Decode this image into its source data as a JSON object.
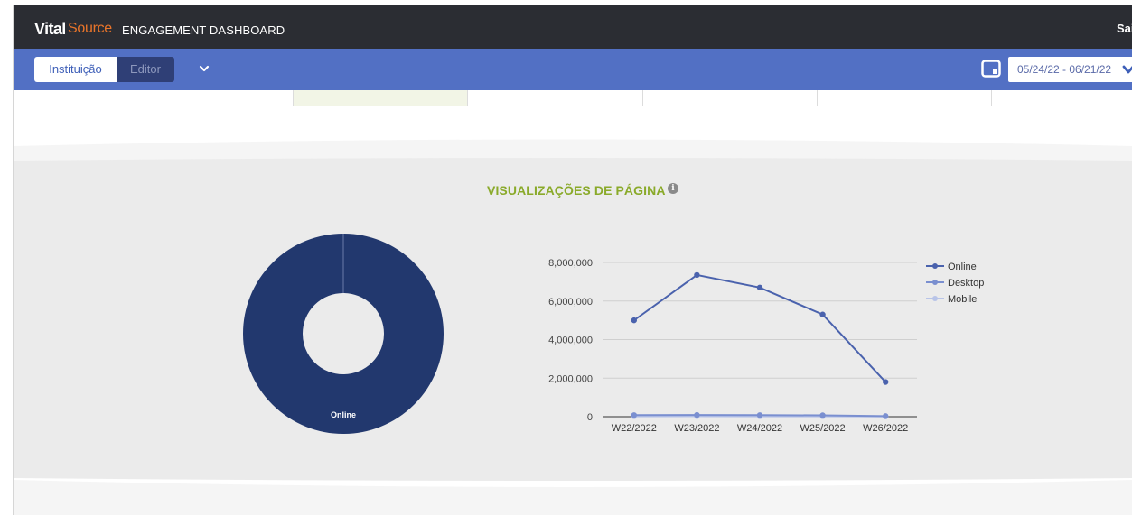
{
  "header": {
    "brand_part1": "Vital",
    "brand_part2": "Source",
    "title": "ENGAGEMENT DASHBOARD",
    "right_text": "Sai"
  },
  "nav": {
    "tabs": [
      {
        "label": "Instituição",
        "active": true
      },
      {
        "label": "Editor",
        "active": false
      }
    ],
    "dropdown_icon": "chevron-down-icon",
    "calendar_icon": "calendar-icon",
    "date_range": "05/24/22 - 06/21/22"
  },
  "section": {
    "title": "VISUALIZAÇÕES DE PÁGINA",
    "info_icon": "i"
  },
  "colors": {
    "topbar": "#2b2d33",
    "navbar": "#5270c4",
    "title_green": "#8aaa2a",
    "online": "#22386e",
    "online_line": "#4a62ad",
    "desktop": "#7a8fd0",
    "mobile": "#b8c4e8"
  },
  "chart_data": [
    {
      "type": "pie",
      "variant": "donut",
      "labels": [
        "Online"
      ],
      "values": [
        100
      ],
      "unit": "percent"
    },
    {
      "type": "line",
      "categories": [
        "W22/2022",
        "W23/2022",
        "W24/2022",
        "W25/2022",
        "W26/2022"
      ],
      "series": [
        {
          "name": "Online",
          "values": [
            5000000,
            7350000,
            6700000,
            5300000,
            1800000
          ]
        },
        {
          "name": "Desktop",
          "values": [
            80000,
            90000,
            80000,
            70000,
            30000
          ]
        },
        {
          "name": "Mobile",
          "values": [
            20000,
            25000,
            20000,
            20000,
            10000
          ]
        }
      ],
      "ylim": [
        0,
        8000000
      ],
      "yticks": [
        0,
        2000000,
        4000000,
        6000000,
        8000000
      ],
      "ytick_labels": [
        "0",
        "2,000,000",
        "4,000,000",
        "6,000,000",
        "8,000,000"
      ],
      "grid": true,
      "legend": "right"
    }
  ]
}
